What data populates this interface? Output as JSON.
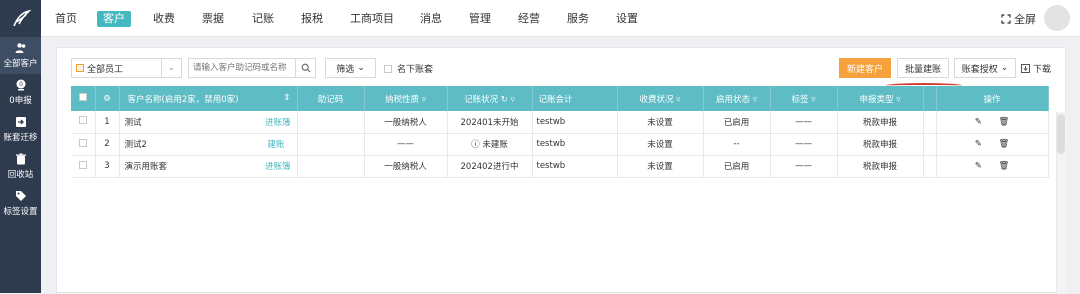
{
  "sidebar": {
    "items": [
      {
        "label": "全部客户",
        "icon": "users-icon"
      },
      {
        "label": "0申报",
        "icon": "zero-report-icon"
      },
      {
        "label": "账套迁移",
        "icon": "migrate-icon"
      },
      {
        "label": "回收站",
        "icon": "trash-icon"
      },
      {
        "label": "标签设置",
        "icon": "tag-icon"
      }
    ]
  },
  "nav": {
    "items": [
      "首页",
      "客户",
      "收费",
      "票据",
      "记账",
      "报税",
      "工商项目",
      "消息",
      "管理",
      "经营",
      "服务",
      "设置"
    ],
    "active": "客户",
    "fullscreen": "全屏"
  },
  "toolbar": {
    "employee_select": "全部员工",
    "search_placeholder": "请输入客户助记码或名称",
    "filter": "筛选",
    "own_books": "名下账套",
    "new_customer": "新建客户",
    "batch_create": "批量建账",
    "authorize": "账套授权",
    "download": "下载"
  },
  "table": {
    "headers": {
      "name": "客户名称(启用2家，禁用0家)",
      "mnemonic": "助记码",
      "tax_type": "纳税性质",
      "bookkeeping": "记账状况",
      "accountant": "记账会计",
      "charge": "收费状况",
      "enabled": "启用状态",
      "tag": "标签",
      "report_type": "申报类型",
      "ops": "操作"
    },
    "rows": [
      {
        "no": "1",
        "name": "测试",
        "link": "进账簿",
        "mnemonic": "",
        "tax_type": "一般纳税人",
        "bookkeeping": "202401未开始",
        "accountant": "testwb",
        "charge": "未设置",
        "enabled": "已启用",
        "tag": "——",
        "report_type": "税款申报"
      },
      {
        "no": "2",
        "name": "测试2",
        "link": "建账",
        "mnemonic": "",
        "tax_type": "——",
        "bookkeeping": "未建账",
        "accountant": "testwb",
        "charge": "未设置",
        "enabled": "--",
        "tag": "——",
        "report_type": "税款申报"
      },
      {
        "no": "3",
        "name": "演示用账套",
        "link": "进账簿",
        "mnemonic": "",
        "tax_type": "一般纳税人",
        "bookkeeping": "202402进行中",
        "accountant": "testwb",
        "charge": "未设置",
        "enabled": "已启用",
        "tag": "——",
        "report_type": "税款申报"
      }
    ]
  },
  "colors": {
    "accent": "#44b8c1",
    "header": "#5dbcc4",
    "orange": "#f5a23c",
    "sidebar": "#2e3b4e",
    "warning": "#e23a3a"
  }
}
